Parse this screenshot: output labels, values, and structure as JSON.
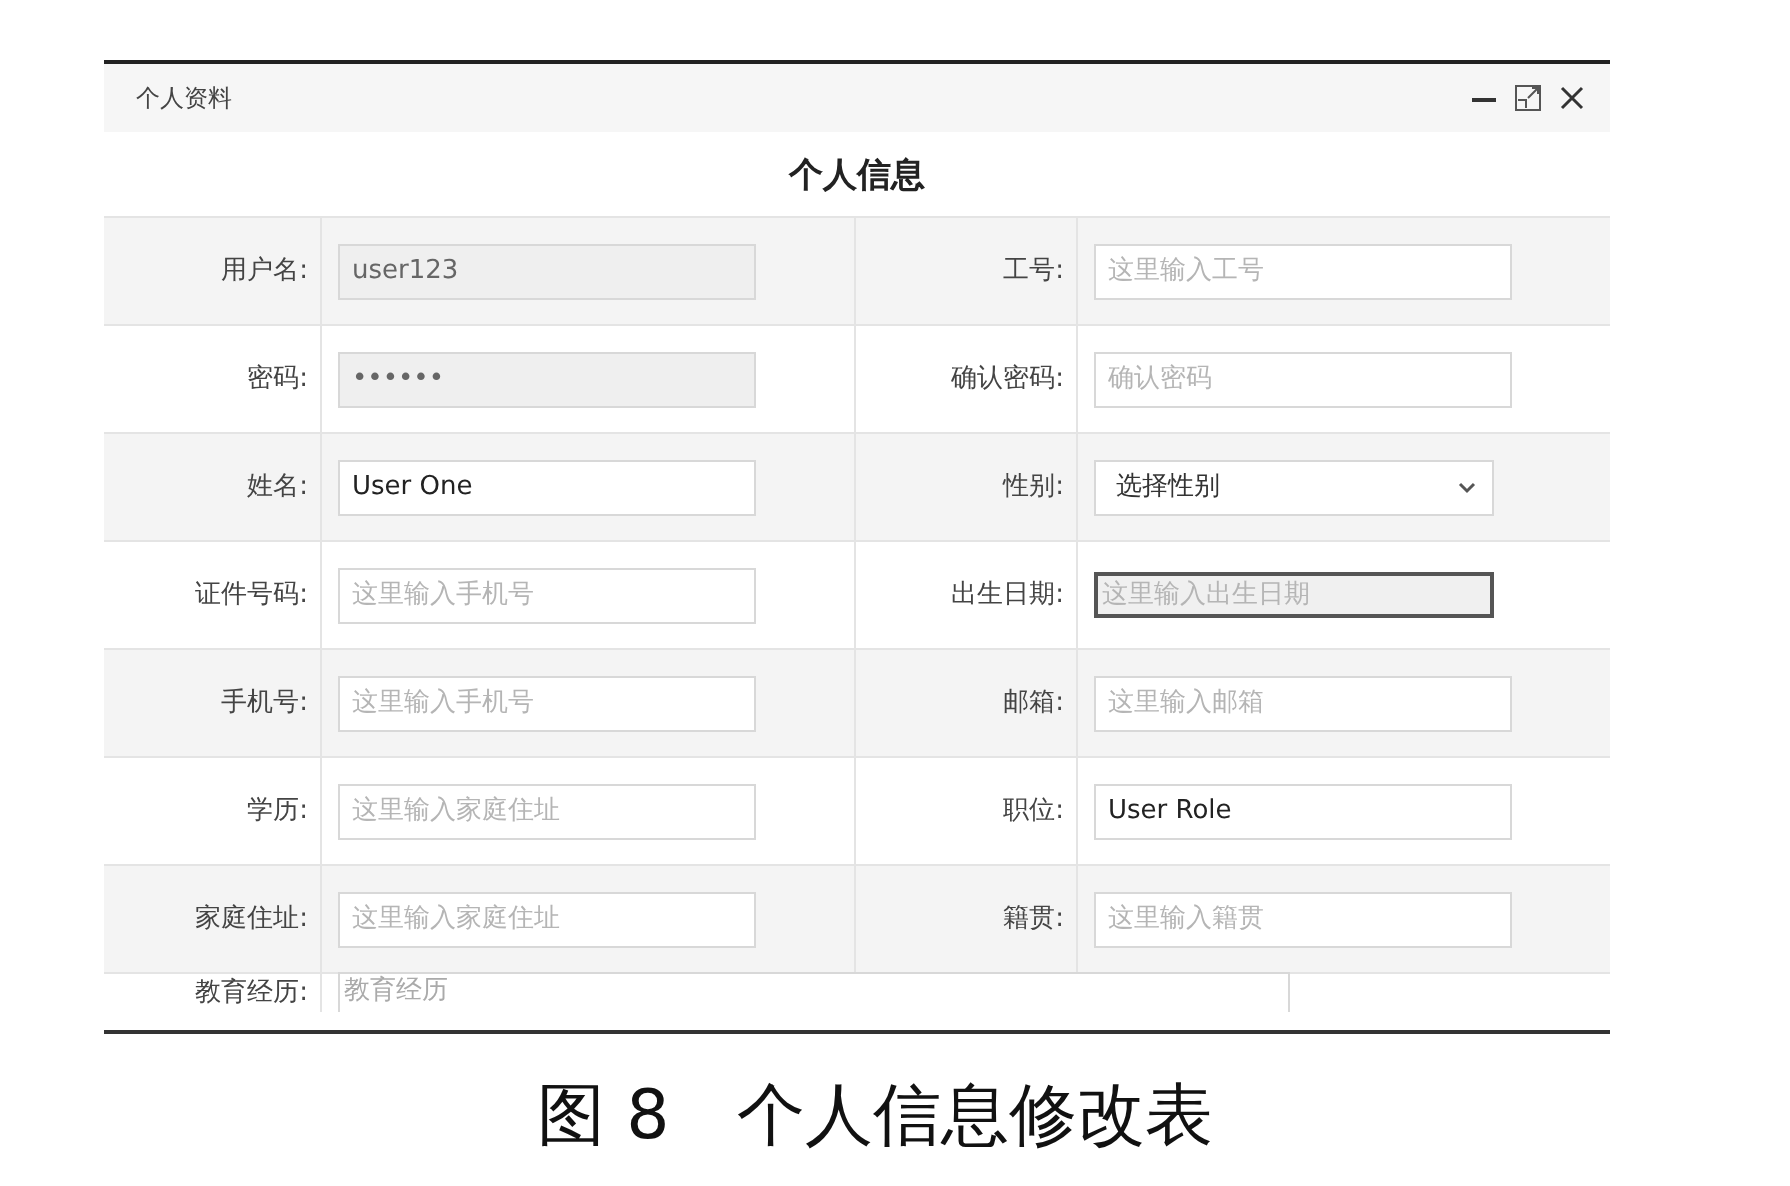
{
  "window": {
    "title": "个人资料"
  },
  "form": {
    "heading": "个人信息",
    "rows": [
      [
        {
          "label": "用户名:",
          "field": {
            "kind": "text",
            "value": "user123",
            "disabled": true
          }
        },
        {
          "label": "工号:",
          "field": {
            "kind": "text",
            "placeholder": "这里输入工号",
            "disabled": false
          }
        }
      ],
      [
        {
          "label": "密码:",
          "field": {
            "kind": "text",
            "value": "••••••",
            "disabled": true
          }
        },
        {
          "label": "确认密码:",
          "field": {
            "kind": "text",
            "placeholder": "确认密码",
            "disabled": false
          }
        }
      ],
      [
        {
          "label": "姓名:",
          "field": {
            "kind": "text",
            "value": "User One",
            "disabled": false
          }
        },
        {
          "label": "性别:",
          "field": {
            "kind": "select",
            "value": "选择性别"
          }
        }
      ],
      [
        {
          "label": "证件号码:",
          "field": {
            "kind": "text",
            "placeholder": "这里输入手机号",
            "disabled": false
          }
        },
        {
          "label": "出生日期:",
          "field": {
            "kind": "plain",
            "placeholder": "这里输入出生日期"
          }
        }
      ],
      [
        {
          "label": "手机号:",
          "field": {
            "kind": "text",
            "placeholder": "这里输入手机号",
            "disabled": false
          }
        },
        {
          "label": "邮箱:",
          "field": {
            "kind": "text",
            "placeholder": "这里输入邮箱",
            "disabled": false
          }
        }
      ],
      [
        {
          "label": "学历:",
          "field": {
            "kind": "text",
            "placeholder": "这里输入家庭住址",
            "disabled": false
          }
        },
        {
          "label": "职位:",
          "field": {
            "kind": "text",
            "value": "User Role",
            "disabled": false
          }
        }
      ],
      [
        {
          "label": "家庭住址:",
          "field": {
            "kind": "text",
            "placeholder": "这里输入家庭住址",
            "disabled": false
          }
        },
        {
          "label": "籍贯:",
          "field": {
            "kind": "text",
            "placeholder": "这里输入籍贯",
            "disabled": false
          }
        }
      ]
    ],
    "last": {
      "label": "教育经历:",
      "field": {
        "kind": "textarea",
        "placeholder": "教育经历"
      }
    }
  },
  "caption": "图 8　个人信息修改表"
}
